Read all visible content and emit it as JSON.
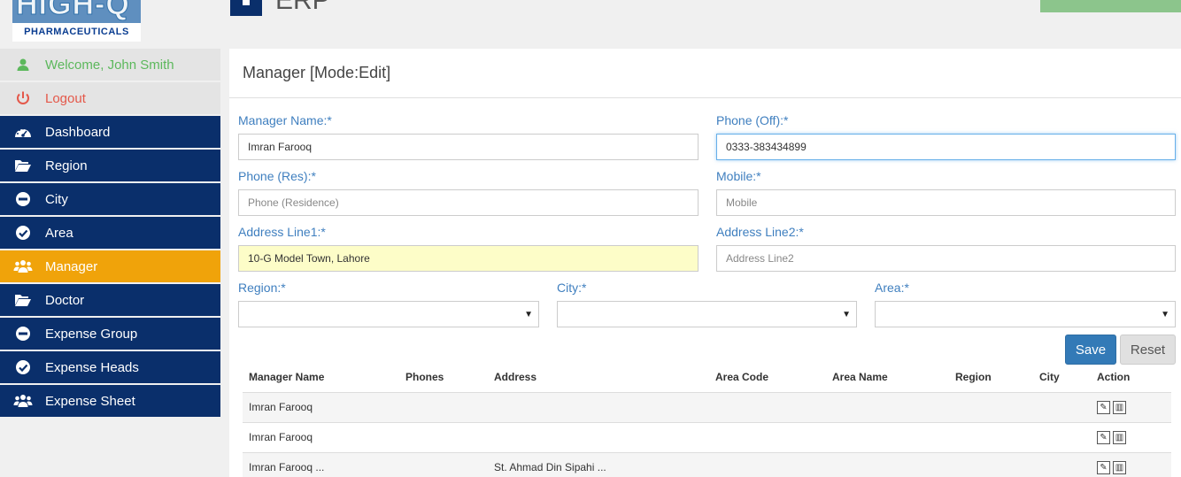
{
  "logo": {
    "brand": "HIGH-Q",
    "sub": "PHARMACEUTICALS"
  },
  "app": {
    "title": "ERP"
  },
  "sidebar": {
    "welcome": "Welcome, John Smith",
    "logout": "Logout",
    "items": [
      {
        "label": "Dashboard",
        "icon": "dashboard-icon"
      },
      {
        "label": "Region",
        "icon": "folder-open-icon"
      },
      {
        "label": "City",
        "icon": "minus-circle-icon"
      },
      {
        "label": "Area",
        "icon": "check-circle-icon"
      },
      {
        "label": "Manager",
        "icon": "users-icon",
        "active": true
      },
      {
        "label": "Doctor",
        "icon": "folder-open-icon"
      },
      {
        "label": "Expense Group",
        "icon": "minus-circle-icon"
      },
      {
        "label": "Expense Heads",
        "icon": "check-circle-icon"
      },
      {
        "label": "Expense Sheet",
        "icon": "users-icon"
      }
    ]
  },
  "form": {
    "title": "Manager [Mode:Edit]",
    "manager_name": {
      "label": "Manager Name:*",
      "value": "Imran Farooq"
    },
    "phone_off": {
      "label": "Phone (Off):*",
      "value": "0333-383434899"
    },
    "phone_res": {
      "label": "Phone (Res):*",
      "placeholder": "Phone (Residence)"
    },
    "mobile": {
      "label": "Mobile:*",
      "placeholder": "Mobile"
    },
    "address1": {
      "label": "Address Line1:*",
      "value": "10-G Model Town, Lahore"
    },
    "address2": {
      "label": "Address Line2:*",
      "placeholder": "Address Line2"
    },
    "region": {
      "label": "Region:*"
    },
    "city": {
      "label": "City:*"
    },
    "area": {
      "label": "Area:*"
    },
    "save": "Save",
    "reset": "Reset"
  },
  "table": {
    "headers": [
      "Manager Name",
      "Phones",
      "Address",
      "Area Code",
      "Area Name",
      "Region",
      "City",
      "Action"
    ],
    "rows": [
      [
        "Imran Farooq",
        "",
        "",
        "",
        "",
        "",
        ""
      ],
      [
        "Imran Farooq",
        "",
        "",
        "",
        "",
        "",
        ""
      ],
      [
        "Imran Farooq ...",
        "",
        "St. Ahmad Din Sipahi ...",
        "",
        "",
        "",
        ""
      ]
    ]
  },
  "colors": {
    "navy": "#0a2f6b",
    "active": "#f0a30a",
    "label_blue": "#3f7fbf",
    "save_blue": "#337ab7"
  }
}
